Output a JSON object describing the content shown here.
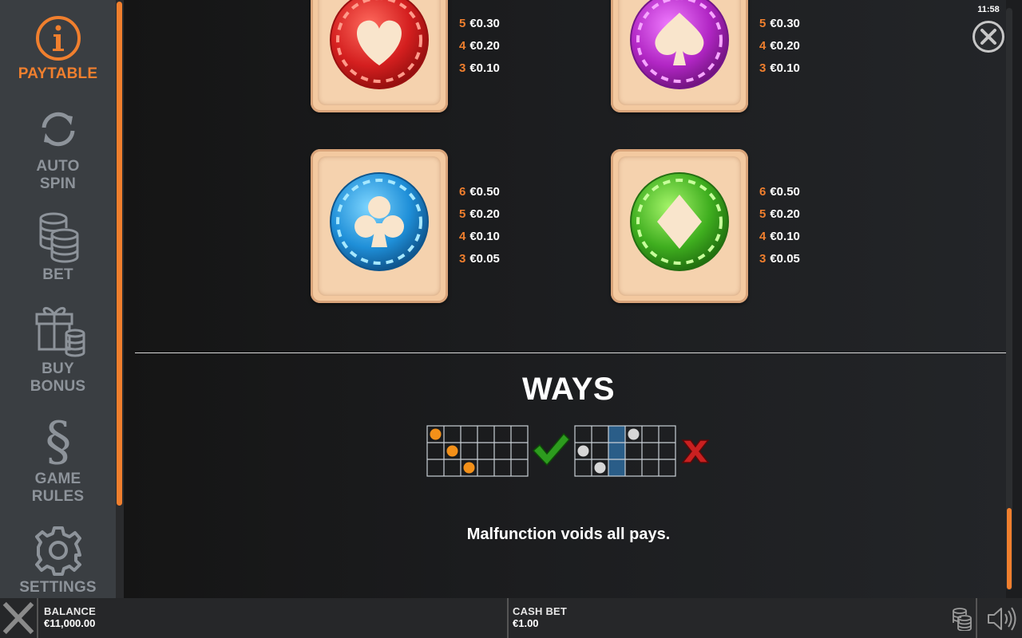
{
  "sidebar": {
    "items": [
      {
        "label": "PAYTABLE"
      },
      {
        "label": "AUTO SPIN",
        "line1": "AUTO",
        "line2": "SPIN"
      },
      {
        "label": "BET"
      },
      {
        "label": "BUY BONUS",
        "line1": "BUY",
        "line2": "BONUS"
      },
      {
        "label": "GAME RULES",
        "line1": "GAME",
        "line2": "RULES"
      },
      {
        "label": "SETTINGS"
      }
    ],
    "active": "PAYTABLE",
    "accent": "#f07f2e"
  },
  "status": {
    "time": "11:58"
  },
  "symbols": [
    {
      "name": "heart-chip",
      "color": "#d42121",
      "suit": "heart",
      "pays": [
        {
          "count": "5",
          "amount": "€0.30"
        },
        {
          "count": "4",
          "amount": "€0.20"
        },
        {
          "count": "3",
          "amount": "€0.10"
        }
      ]
    },
    {
      "name": "spade-chip",
      "color": "#b126c4",
      "suit": "spade",
      "pays": [
        {
          "count": "5",
          "amount": "€0.30"
        },
        {
          "count": "4",
          "amount": "€0.20"
        },
        {
          "count": "3",
          "amount": "€0.10"
        }
      ]
    },
    {
      "name": "club-chip",
      "color": "#1f8fd8",
      "suit": "club",
      "pays": [
        {
          "count": "6",
          "amount": "€0.50"
        },
        {
          "count": "5",
          "amount": "€0.20"
        },
        {
          "count": "4",
          "amount": "€0.10"
        },
        {
          "count": "3",
          "amount": "€0.05"
        }
      ]
    },
    {
      "name": "diamond-chip",
      "color": "#3fae1f",
      "suit": "diamond",
      "pays": [
        {
          "count": "6",
          "amount": "€0.50"
        },
        {
          "count": "5",
          "amount": "€0.20"
        },
        {
          "count": "4",
          "amount": "€0.10"
        },
        {
          "count": "3",
          "amount": "€0.05"
        }
      ]
    }
  ],
  "ways": {
    "title": "WAYS",
    "valid_example": "checkmark",
    "invalid_example": "cross"
  },
  "disclaimer": "Malfunction voids all pays.",
  "bottom_bar": {
    "balance_label": "BALANCE",
    "balance_value": "€11,000.00",
    "bet_label": "CASH BET",
    "bet_value": "€1.00"
  }
}
